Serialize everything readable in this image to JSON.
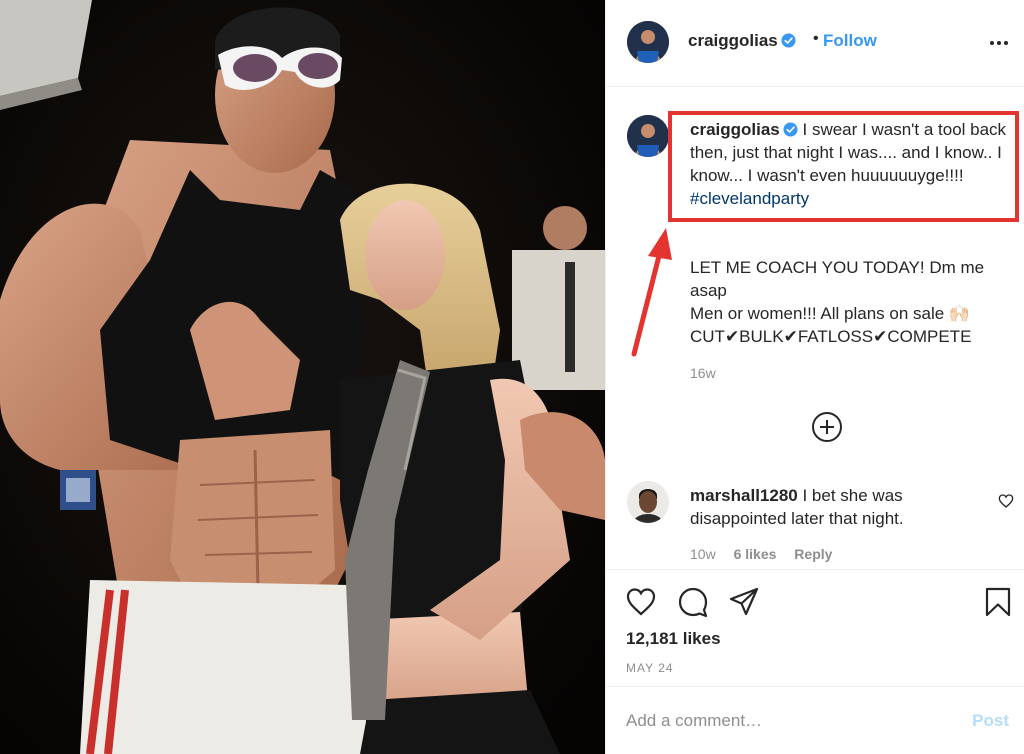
{
  "header": {
    "username": "craiggolias",
    "separator": "•",
    "follow_label": "Follow",
    "more_icon": "more-horizontal-icon",
    "verified_icon": "verified-badge-icon"
  },
  "caption": {
    "username": "craiggolias",
    "text": "I swear I wasn't a tool back then, just that night I was.... and I know.. I know... I wasn't even huuuuuuyge!!!! ",
    "hashtag": "#clevelandparty"
  },
  "promo": {
    "line1": "LET ME COACH YOU TODAY! Dm me asap",
    "line2": "Men or women!!! All plans on sale 🙌🏻",
    "line3": "CUT✔BULK✔FATLOSS✔COMPETE",
    "age": "16w"
  },
  "load_more_icon": "plus-circle-icon",
  "comment": {
    "username": "marshall1280",
    "text": "I bet she was disappointed later that night.",
    "age": "10w",
    "likes": "6 likes",
    "reply_label": "Reply"
  },
  "actions": {
    "likes": "12,181 likes",
    "date": "MAY 24"
  },
  "add_comment": {
    "placeholder": "Add a comment…",
    "post_label": "Post"
  },
  "colors": {
    "link_blue": "#3897f0",
    "hashtag_blue": "#00376b",
    "annotation_red": "#e3342f",
    "muted_gray": "#8e8e8e",
    "disabled_post": "#b2dffc"
  }
}
